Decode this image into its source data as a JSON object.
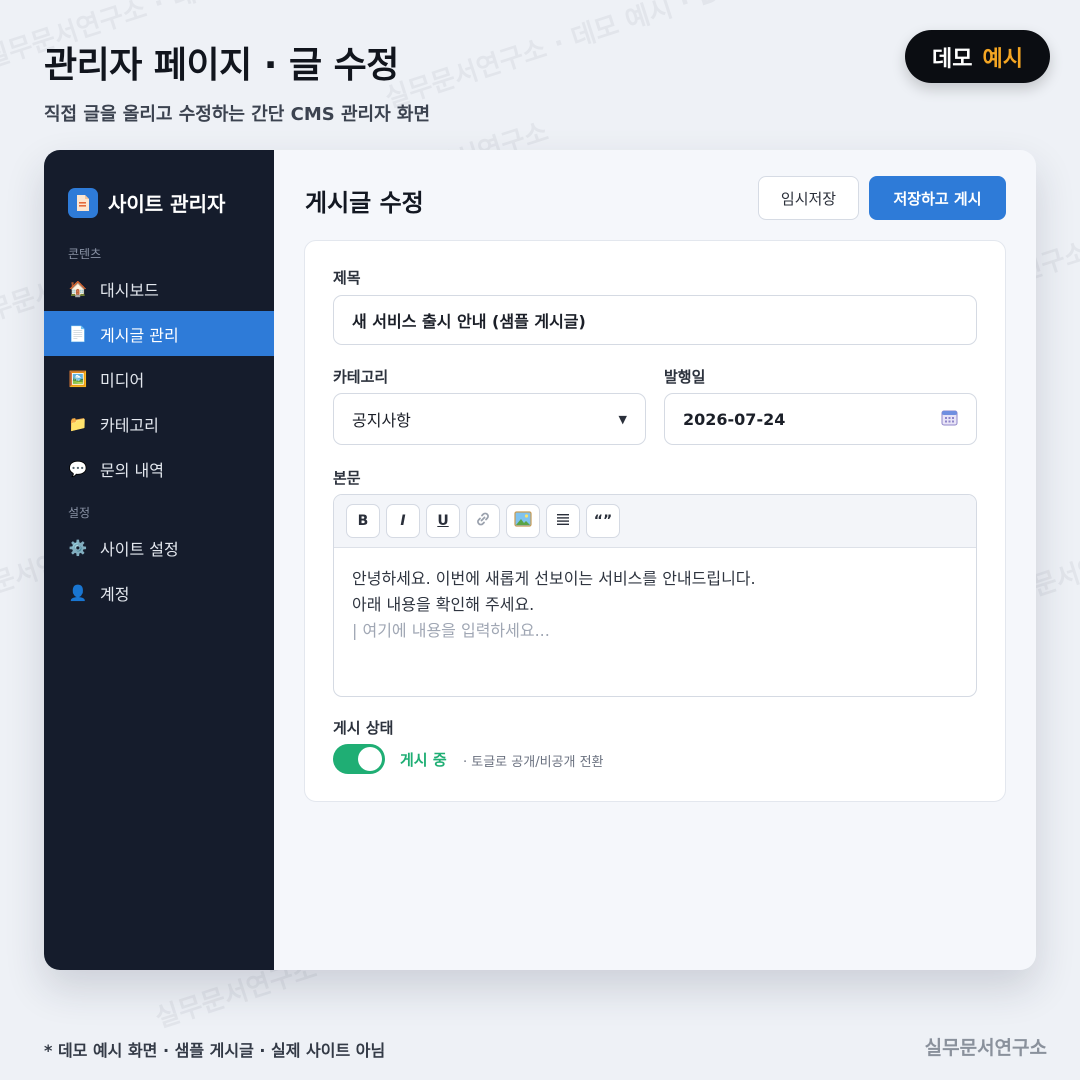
{
  "header": {
    "title": "관리자 페이지 · 글 수정",
    "subtitle": "직접 글을 올리고 수정하는 간단 CMS 관리자 화면"
  },
  "badge": {
    "primary": "데모",
    "accent": "예시",
    "accent_color": "#f5a623"
  },
  "watermark": {
    "text": "실무문서연구소 · 데모 예시 · DEMO · 실무문서연구소"
  },
  "sidebar": {
    "brand": "사이트 관리자",
    "sections": [
      {
        "label": "콘텐츠",
        "items": [
          {
            "label": "대시보드",
            "icon": "house-icon"
          },
          {
            "label": "게시글 관리",
            "icon": "document-icon",
            "active": true
          },
          {
            "label": "미디어",
            "icon": "image-icon"
          },
          {
            "label": "카테고리",
            "icon": "folder-icon"
          },
          {
            "label": "문의 내역",
            "icon": "speech-bubble-icon"
          }
        ]
      },
      {
        "label": "설정",
        "items": [
          {
            "label": "사이트 설정",
            "icon": "gear-icon"
          },
          {
            "label": "계정",
            "icon": "user-icon"
          }
        ]
      }
    ]
  },
  "main": {
    "title": "게시글 수정",
    "draft_button": "임시저장",
    "publish_button": "저장하고 게시",
    "form": {
      "title_label": "제목",
      "title_value": "새 서비스 출시 안내 (샘플 게시글)",
      "category_label": "카테고리",
      "category_value": "공지사항",
      "date_label": "발행일",
      "date_value": "2026-07-24",
      "body_label": "본문",
      "toolbar": [
        "B",
        "I",
        "U",
        "link-icon",
        "image-icon",
        "list-icon",
        "quote-icon"
      ],
      "body_lines": [
        "안녕하세요. 이번에 새롭게 선보이는 서비스를 안내드립니다.",
        "아래 내용을 확인해 주세요."
      ],
      "body_placeholder": "| 여기에 내용을 입력하세요...",
      "status_label": "게시 상태",
      "status_value": "게시 중",
      "status_hint": "· 토글로 공개/비공개 전환",
      "status_on": true
    }
  },
  "footer": {
    "note": "* 데모 예시 화면 · 샘플 게시글 · 실제 사이트 아님",
    "brand": "실무문서연구소"
  },
  "colors": {
    "primary": "#2e7bd8",
    "sidebar_bg": "#151c2c",
    "success": "#1fae74"
  }
}
